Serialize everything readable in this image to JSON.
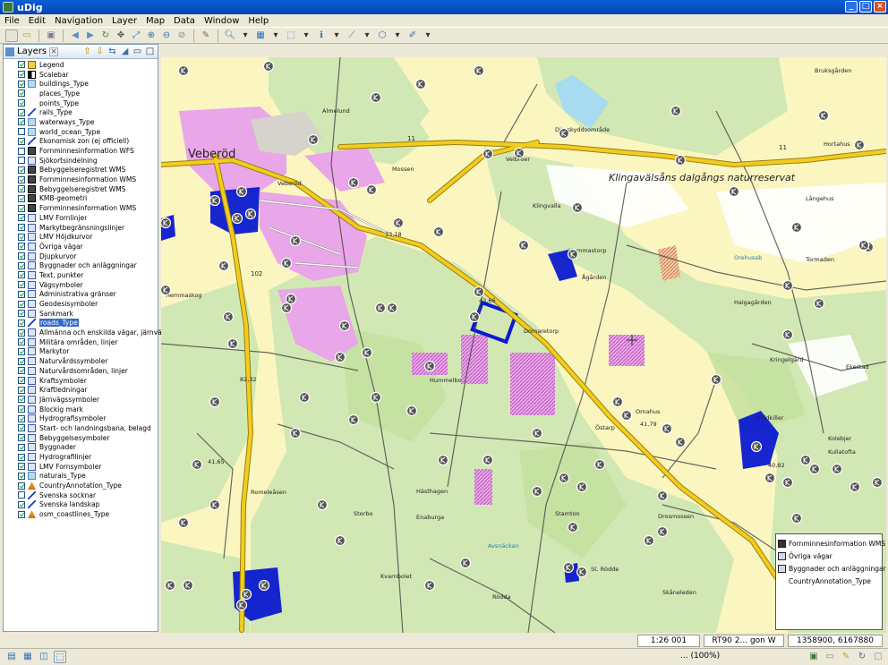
{
  "app": {
    "title": "uDig"
  },
  "window_controls": {
    "minimize": "_",
    "maximize": "□",
    "close": "×"
  },
  "menu": [
    "File",
    "Edit",
    "Navigation",
    "Layer",
    "Map",
    "Data",
    "Window",
    "Help"
  ],
  "layers_panel": {
    "tab_title": "Layers",
    "layers": [
      {
        "name": "Legend",
        "checked": true,
        "icon": "legend-icon"
      },
      {
        "name": "Scalebar",
        "checked": true,
        "icon": "scalebar-icon"
      },
      {
        "name": "buildings_Type",
        "checked": true,
        "icon": "polygon-icon"
      },
      {
        "name": "places_Type",
        "checked": true,
        "icon": "point-icon"
      },
      {
        "name": "points_Type",
        "checked": true,
        "icon": "point-icon"
      },
      {
        "name": "rails_Type",
        "checked": true,
        "icon": "line-icon"
      },
      {
        "name": "waterways_Type",
        "checked": true,
        "icon": "polygon-icon"
      },
      {
        "name": "world_ocean_Type",
        "checked": false,
        "icon": "polygon-icon"
      },
      {
        "name": "Ekonomisk zon (ej officiell)",
        "checked": true,
        "icon": "line-icon"
      },
      {
        "name": "Fornminnesinformation WFS",
        "checked": false,
        "icon": "wfs-icon"
      },
      {
        "name": "Sjökortsindelning",
        "checked": false,
        "icon": "grid-icon"
      },
      {
        "name": "Bebyggelseregistret WMS",
        "checked": true,
        "icon": "wms-icon"
      },
      {
        "name": "Fornminnesinformation WMS",
        "checked": true,
        "icon": "wms-icon"
      },
      {
        "name": "Bebyggelseregistret WMS",
        "checked": true,
        "icon": "wms-icon"
      },
      {
        "name": "KMB-geometri",
        "checked": true,
        "icon": "wms-icon"
      },
      {
        "name": "Fornminnesinformation WMS",
        "checked": true,
        "icon": "wms-icon"
      },
      {
        "name": "LMV Fornlinjer",
        "checked": true,
        "icon": "grid-icon"
      },
      {
        "name": "Markytbegränsningslinjer",
        "checked": true,
        "icon": "grid-icon"
      },
      {
        "name": "LMV Höjdkurvor",
        "checked": true,
        "icon": "grid-icon"
      },
      {
        "name": "Övriga vägar",
        "checked": true,
        "icon": "grid-icon"
      },
      {
        "name": "Djupkurvor",
        "checked": true,
        "icon": "grid-icon"
      },
      {
        "name": "Byggnader och anläggningar",
        "checked": true,
        "icon": "grid-icon"
      },
      {
        "name": "Text, punkter",
        "checked": true,
        "icon": "grid-icon"
      },
      {
        "name": "Vägsymboler",
        "checked": true,
        "icon": "grid-icon"
      },
      {
        "name": "Administrativa gränser",
        "checked": true,
        "icon": "grid-icon"
      },
      {
        "name": "Geodesisymboler",
        "checked": true,
        "icon": "grid-icon"
      },
      {
        "name": "Sankmark",
        "checked": true,
        "icon": "grid-icon"
      },
      {
        "name": "roads_Type",
        "checked": true,
        "icon": "line-icon",
        "selected": true
      },
      {
        "name": "Allmänna och enskilda vägar, järnvägar",
        "checked": true,
        "icon": "grid-icon"
      },
      {
        "name": "Militära områden, linjer",
        "checked": true,
        "icon": "grid-icon"
      },
      {
        "name": "Markytor",
        "checked": true,
        "icon": "grid-icon"
      },
      {
        "name": "Naturvårdssymboler",
        "checked": true,
        "icon": "grid-icon"
      },
      {
        "name": "Naturvårdsområden, linjer",
        "checked": true,
        "icon": "grid-icon"
      },
      {
        "name": "Kraftsymboler",
        "checked": true,
        "icon": "grid-icon"
      },
      {
        "name": "Kraftledningar",
        "checked": true,
        "icon": "grid-icon"
      },
      {
        "name": "Järnvägssymboler",
        "checked": true,
        "icon": "grid-icon"
      },
      {
        "name": "Blockig mark",
        "checked": true,
        "icon": "grid-icon"
      },
      {
        "name": "Hydrografisymboler",
        "checked": true,
        "icon": "grid-icon"
      },
      {
        "name": "Start- och landningsbana, belagd",
        "checked": true,
        "icon": "grid-icon"
      },
      {
        "name": "Bebyggelsesymboler",
        "checked": true,
        "icon": "grid-icon"
      },
      {
        "name": "Byggnader",
        "checked": true,
        "icon": "grid-icon"
      },
      {
        "name": "Hydrografilinjer",
        "checked": true,
        "icon": "grid-icon"
      },
      {
        "name": "LMV Fornsymboler",
        "checked": true,
        "icon": "grid-icon"
      },
      {
        "name": "naturals_Type",
        "checked": true,
        "icon": "polygon-icon"
      },
      {
        "name": "CountryAnnotation_Type",
        "checked": true,
        "icon": "annotation-icon"
      },
      {
        "name": "Svenska socknar",
        "checked": false,
        "icon": "line-icon"
      },
      {
        "name": "Svenska landskap",
        "checked": true,
        "icon": "line-icon"
      },
      {
        "name": "osm_coastlines_Type",
        "checked": true,
        "icon": "annotation-icon"
      }
    ]
  },
  "map": {
    "labels": {
      "veberod": "Veberöd",
      "naturreservat": "Klingavälsåns dalgångs naturreservat",
      "nr11a": "11",
      "nr11b": "11",
      "nr102": "102",
      "almelund": "Almelund",
      "mossen": "Mossen",
      "veberod_small": "Veberöd",
      "velbroer": "Velbroer",
      "djurskyddsomrade": "Djurskyddsområde",
      "bruksgarden": "Bruksgården",
      "hortahus": "Hortahus",
      "langehus": "Långehus",
      "klingvalla": "Klingvalla",
      "hummastorp": "Hummastorp",
      "agardsen": "Ågården",
      "domaretorp": "Domaretorp",
      "halgagarden": "Halgagården",
      "ornahus": "Ornahus",
      "hasthagen": "Hästhagen",
      "enaburga": "Enaburga",
      "romeleasen": "Romeleåsen",
      "storbo": "Storbo",
      "stamton": "Stamton",
      "drosmossen": "Drosmossen",
      "ostarp": "Östarp",
      "kvarnbolet": "Kvarnbolet",
      "st_rodde": "St. Rödde",
      "skaneleden": "Skåneleden",
      "rodda": "Rödda",
      "hvidkiller": "Hvidkiller",
      "kolebjer": "Kolebjer",
      "kullatofta": "Kullatofta",
      "kringelgard": "Kringelgård",
      "hemmaskog": "Hemmaskog",
      "tormaden": "Tormaden",
      "ekestad": "Ekestad",
      "e4366": "43,66",
      "e3318": "33,18",
      "e8232": "82,32",
      "e4179": "41,79",
      "e4082": "40,82",
      "e4165": "41,65",
      "orehusab": "Orehusab",
      "hummelbo": "Hummelbo",
      "avsnackan": "Avsnäckan"
    }
  },
  "legend": {
    "items": [
      {
        "name": "Fornminnesinformation WMS",
        "icon": "wms-icon"
      },
      {
        "name": "Övriga vägar",
        "icon": "grid-icon"
      },
      {
        "name": "Byggnader och anläggningar",
        "icon": "grid-icon"
      },
      {
        "name": "CountryAnnotation_Type",
        "icon": ""
      }
    ]
  },
  "map_status": {
    "scale": "1:26 001",
    "crs": "RT90 2... gon W",
    "coordinates": "1358900, 6167880"
  },
  "status_bar": {
    "zoom": "... (100%)"
  },
  "colors": {
    "titlebar": "#0842b0",
    "map_base": "#fbf6c0",
    "forest": "#d2e8b4",
    "main_road": "#f2cd1e",
    "urban": "#e9a6e8",
    "water_blue": "#0b1ad0",
    "selection": "#316ac5"
  }
}
